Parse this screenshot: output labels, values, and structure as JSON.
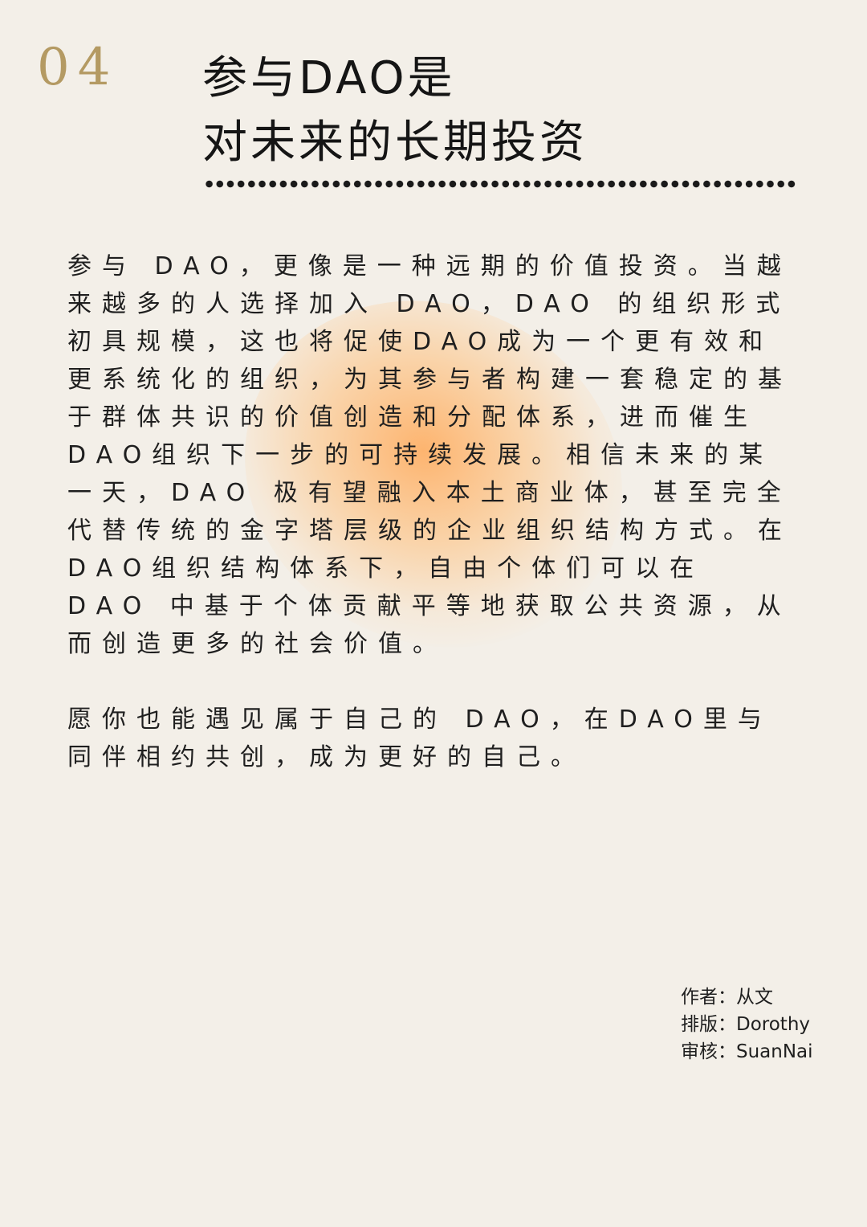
{
  "section": {
    "number": "04"
  },
  "title": {
    "line1": "参与DAO是",
    "line2": "对未来的长期投资"
  },
  "body": {
    "paragraph1": "参与 DAO，更像是一种远期的价值投资。当越来越多的人选择加入 DAO，DAO 的组织形式初具规模，这也将促使DAO成为一个更有效和更系统化的组织，为其参与者构建一套稳定的基于群体共识的价值创造和分配体系，进而催生DAO组织下一步的可持续发展。相信未来的某一天，DAO 极有望融入本土商业体，甚至完全代替传统的金字塔层级的企业组织结构方式。在DAO组织结构体系下，自由个体们可以在 DAO 中基于个体贡献平等地获取公共资源，从而创造更多的社会价值。",
    "paragraph2": "愿你也能遇见属于自己的 DAO，在DAO里与同伴相约共创，成为更好的自己。"
  },
  "credits": {
    "author": "作者：从文",
    "layout": "排版：Dorothy",
    "review": "审核：SuanNai"
  },
  "colors": {
    "background": "#f3efe8",
    "accent_gold": "#b49a63",
    "text": "#1f1f1f",
    "glow": "#ffaa5a"
  }
}
